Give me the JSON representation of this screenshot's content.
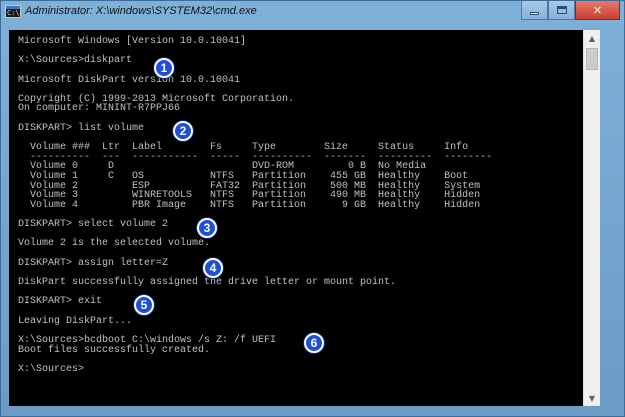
{
  "window": {
    "title": "Administrator: X:\\windows\\SYSTEM32\\cmd.exe",
    "minimize_glyph": "",
    "maximize_glyph": "",
    "close_glyph": "✕"
  },
  "console": {
    "lines": [
      "Microsoft Windows [Version 10.0.10041]",
      "",
      "X:\\Sources>diskpart",
      "",
      "Microsoft DiskPart version 10.0.10041",
      "",
      "Copyright (C) 1999-2013 Microsoft Corporation.",
      "On computer: MININT-R7PPJ66",
      "",
      "DISKPART> list volume",
      "",
      "  Volume ###  Ltr  Label        Fs     Type        Size     Status     Info",
      "  ----------  ---  -----------  -----  ----------  -------  ---------  --------",
      "  Volume 0     D                       DVD-ROM         0 B  No Media",
      "  Volume 1     C   OS           NTFS   Partition    455 GB  Healthy    Boot",
      "  Volume 2         ESP          FAT32  Partition    500 MB  Healthy    System",
      "  Volume 3         WINRETOOLS   NTFS   Partition    490 MB  Healthy    Hidden",
      "  Volume 4         PBR Image    NTFS   Partition      9 GB  Healthy    Hidden",
      "",
      "DISKPART> select volume 2",
      "",
      "Volume 2 is the selected volume.",
      "",
      "DISKPART> assign letter=Z",
      "",
      "DiskPart successfully assigned the drive letter or mount point.",
      "",
      "DISKPART> exit",
      "",
      "Leaving DiskPart...",
      "",
      "X:\\Sources>bcdboot C:\\windows /s Z: /f UEFI",
      "Boot files successfully created.",
      "",
      "X:\\Sources>"
    ]
  },
  "badges": [
    {
      "label": "1"
    },
    {
      "label": "2"
    },
    {
      "label": "3"
    },
    {
      "label": "4"
    },
    {
      "label": "5"
    },
    {
      "label": "6"
    }
  ],
  "colors": {
    "console_bg": "#000000",
    "console_text": "#c0c0c0",
    "badge": "#1f4fd8"
  }
}
